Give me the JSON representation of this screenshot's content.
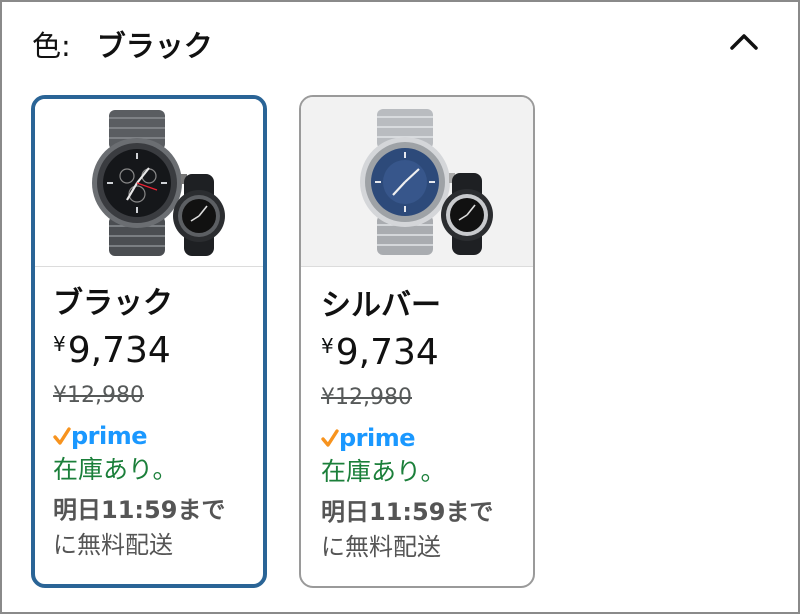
{
  "header": {
    "label": "色:",
    "selected_value": "ブラック"
  },
  "variants": [
    {
      "name": "ブラック",
      "currency": "¥",
      "price": "9,734",
      "list_price": "¥12,980",
      "prime": "prime",
      "stock": "在庫あり。",
      "delivery_bold": "明日11:59まで",
      "delivery_rest": "に無料配送",
      "selected": true,
      "icon": "watch-black-image"
    },
    {
      "name": "シルバー",
      "currency": "¥",
      "price": "9,734",
      "list_price": "¥12,980",
      "prime": "prime",
      "stock": "在庫あり。",
      "delivery_bold": "明日11:59まで",
      "delivery_rest": "に無料配送",
      "selected": false,
      "icon": "watch-silver-image"
    }
  ],
  "colors": {
    "selected_border": "#2a6496",
    "stock_green": "#1b7f3a",
    "prime_blue": "#1a98ff",
    "prime_check": "#f7931e"
  }
}
